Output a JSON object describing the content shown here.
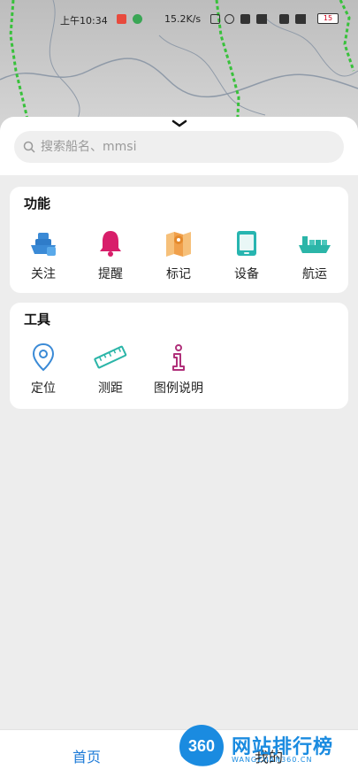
{
  "status_bar": {
    "time": "上午10:34",
    "net_speed": "15.2K/s",
    "battery": "15"
  },
  "search": {
    "placeholder": "搜索船名、mmsi"
  },
  "functions": {
    "title": "功能",
    "items": [
      {
        "label": "关注",
        "icon": "ship-follow-icon"
      },
      {
        "label": "提醒",
        "icon": "bell-icon"
      },
      {
        "label": "标记",
        "icon": "map-pin-icon"
      },
      {
        "label": "设备",
        "icon": "tablet-icon"
      },
      {
        "label": "航运",
        "icon": "cargo-ship-icon"
      }
    ]
  },
  "tools": {
    "title": "工具",
    "items": [
      {
        "label": "定位",
        "icon": "location-pin-icon"
      },
      {
        "label": "测距",
        "icon": "ruler-icon"
      },
      {
        "label": "图例说明",
        "icon": "info-icon"
      }
    ]
  },
  "bottom_nav": {
    "home": "首页",
    "mine": "我的"
  },
  "watermark": {
    "badge": "360",
    "title": "网站排行榜",
    "subtitle": "WANGZHAN360.CN"
  },
  "colors": {
    "accent": "#1e7bd8",
    "bell": "#d81e6a",
    "map": "#f0a04b",
    "tablet": "#27b5b0",
    "ship": "#2bb5a8",
    "pin": "#3a8ad6",
    "ruler": "#2bb5a8",
    "info": "#b0307a"
  }
}
